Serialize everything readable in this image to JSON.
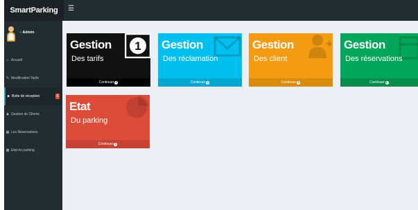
{
  "brand": "SmartParking",
  "user": {
    "name": "Admin"
  },
  "menu": [
    {
      "label": "Accueil",
      "icon": "home-icon"
    },
    {
      "label": "Modification Tarifs",
      "icon": "wrench-icon"
    },
    {
      "label": "Boite de réception",
      "icon": "inbox-icon",
      "badge": "6"
    },
    {
      "label": "Gestion de Clients",
      "icon": "users-icon"
    },
    {
      "label": "Les Réservations",
      "icon": "calendar-icon"
    },
    {
      "label": "Etat du parking",
      "icon": "car-icon"
    }
  ],
  "tiles": [
    {
      "title": "Gestion",
      "subtitle": "Des tarifs",
      "footer": "Continuer",
      "color": "#111111",
      "icon": "banknote-icon"
    },
    {
      "title": "Gestion",
      "subtitle": "Des réclamation",
      "footer": "Continuer",
      "color": "#00c0ef",
      "icon": "envelope-icon"
    },
    {
      "title": "Gestion",
      "subtitle": "Des client",
      "footer": "Continuer",
      "color": "#f39c12",
      "icon": "user-add-icon"
    },
    {
      "title": "Gestion",
      "subtitle": "Des réservations",
      "footer": "Continuer",
      "color": "#00a65a",
      "icon": "table-icon"
    },
    {
      "title": "Etat",
      "subtitle": "Du parking",
      "footer": "Continuer",
      "color": "#dd4b39",
      "icon": "pie-chart-icon"
    }
  ]
}
